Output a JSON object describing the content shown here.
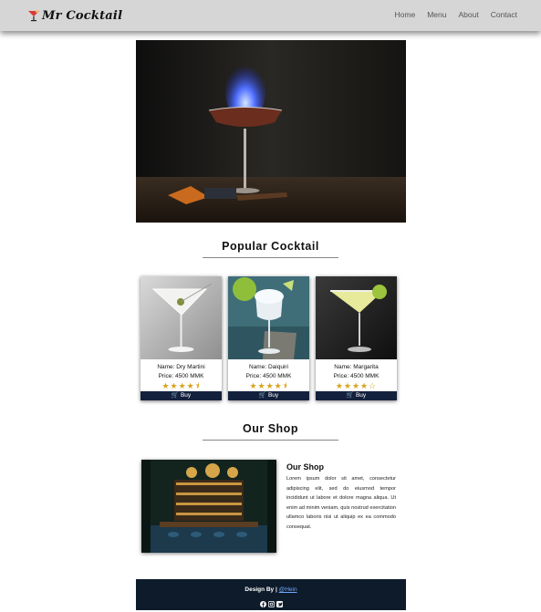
{
  "navbar": {
    "brand": "Mr Cocktail",
    "links": [
      "Home",
      "Menu",
      "About",
      "Contact"
    ]
  },
  "popular": {
    "title": "Popular Cocktail",
    "cards": [
      {
        "name": "Name: Dry Martini",
        "price": "Price: 4500 MMK",
        "stars": "★★★★⯨",
        "rating": 4.5,
        "buy": "Buy"
      },
      {
        "name": "Name: Daiquiri",
        "price": "Price: 4500 MMK",
        "stars": "★★★★⯨",
        "rating": 4.5,
        "buy": "Buy"
      },
      {
        "name": "Name: Margarita",
        "price": "Price: 4500 MMK",
        "stars": "★★★★☆",
        "rating": 4,
        "buy": "Buy"
      }
    ]
  },
  "shop": {
    "title": "Our Shop",
    "heading": "Our Shop",
    "text": "Lorem ipsum dolor sit amet, consectetur adipiscing elit, sed do eiusmod tempor incididunt ut labore et dolore magna aliqua. Ut enim ad minim veniam, quis nostrud exercitation ullamco laboris nisi ut aliquip ex ea commodo consequat."
  },
  "footer": {
    "design_by": "Design By |",
    "author": "@Hein",
    "socials": [
      "facebook-icon",
      "instagram-icon",
      "twitter-icon"
    ]
  },
  "colors": {
    "navbar_bg": "#d6d6d6",
    "buy_bg": "#14213d",
    "footer_bg": "#0d1b2a",
    "star": "#d9a31e",
    "link": "#6ea8fe"
  }
}
